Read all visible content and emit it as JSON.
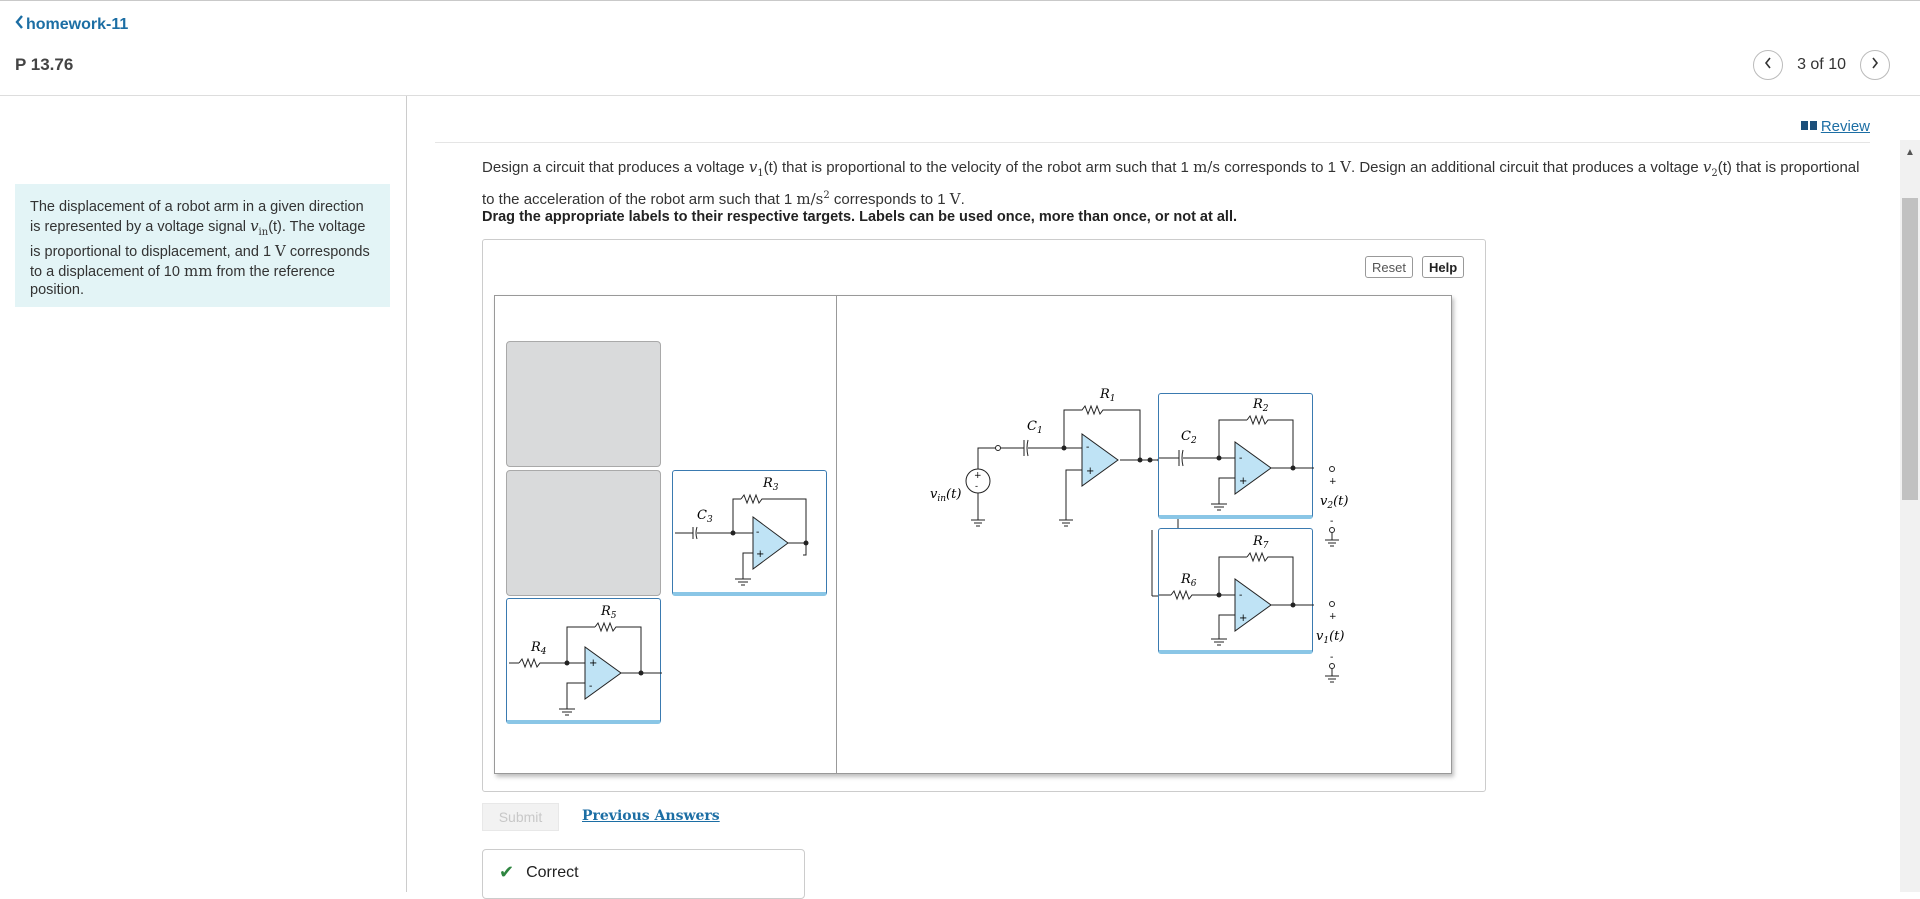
{
  "header": {
    "back_label": "homework-11",
    "problem_title": "P 13.76",
    "pager_text": "3 of 10"
  },
  "intro": {
    "p1": "The displacement of a robot arm in a given direction is represented by a voltage signal ",
    "v_in": "v",
    "v_in_sub": "in",
    "p2": "(t). The voltage is proportional to displacement, and 1 ",
    "unit_v": "V",
    "p3": " corresponds to a displacement of 10 ",
    "unit_mm": "mm",
    "p4": " from the reference position."
  },
  "review_label": "Review",
  "question": {
    "s1": "Design a circuit that produces a voltage ",
    "v1": "v",
    "v1_sub": "1",
    "s2": "(t) that is proportional to the velocity of the robot arm such that 1 ",
    "u1": "m/s",
    "s3": " corresponds to 1 ",
    "u2": "V",
    "s4": ". Design an additional circuit that produces a voltage ",
    "v2": "v",
    "v2_sub": "2",
    "s5": "(t) that is proportional to the acceleration of the robot arm such that 1 ",
    "u3": "m/s",
    "u3_sup": "2",
    "s6": " corresponds to 1 ",
    "u4": "V",
    "s7": "."
  },
  "instruction": "Drag the appropriate labels to their respective targets. Labels can be used once, more than once, or not at all.",
  "buttons": {
    "reset": "Reset",
    "help": "Help",
    "submit": "Submit"
  },
  "previous_answers": "Previous Answers",
  "result": "Correct",
  "circuit_labels": {
    "R1": "R",
    "R1_sub": "1",
    "R2": "R",
    "R2_sub": "2",
    "R3": "R",
    "R3_sub": "3",
    "R4": "R",
    "R4_sub": "4",
    "R5": "R",
    "R5_sub": "5",
    "R6": "R",
    "R6_sub": "6",
    "R7": "R",
    "R7_sub": "7",
    "C1": "C",
    "C1_sub": "1",
    "C2": "C",
    "C2_sub": "2",
    "C3": "C",
    "C3_sub": "3",
    "vin": "v",
    "vin_sub": "in",
    "vin_t": "(t)",
    "v2": "v",
    "v2_sub": "2",
    "v2_t": "(t)",
    "v1": "v",
    "v1_sub": "1",
    "v1_t": "(t)",
    "plus": "+",
    "minus": "-"
  },
  "icons": [
    "chevron-left-icon",
    "chevron-right-icon",
    "book-icon",
    "check-icon",
    "scroll-up-icon"
  ],
  "colors": {
    "link": "#1c6ea4",
    "intro_bg": "#e3f4f6",
    "opamp_fill": "#bfe3f5",
    "correct": "#2e8540"
  }
}
